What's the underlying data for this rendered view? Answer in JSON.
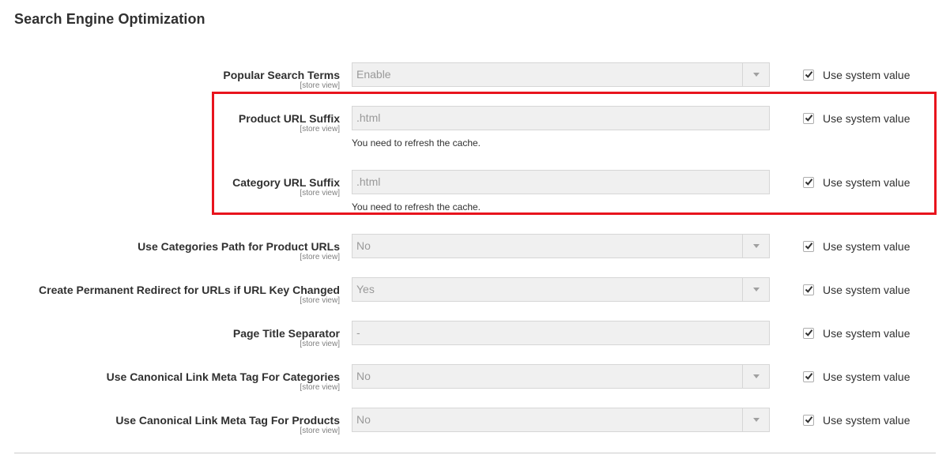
{
  "section": {
    "title": "Search Engine Optimization"
  },
  "rows": [
    {
      "label": "Popular Search Terms",
      "scope": "[store view]",
      "value": "Enable",
      "control": "select",
      "system_value_label": "Use system value",
      "checked": true
    },
    {
      "label": "Product URL Suffix",
      "scope": "[store view]",
      "value": ".html",
      "control": "text",
      "note": "You need to refresh the cache.",
      "system_value_label": "Use system value",
      "checked": true
    },
    {
      "label": "Category URL Suffix",
      "scope": "[store view]",
      "value": ".html",
      "control": "text",
      "note": "You need to refresh the cache.",
      "system_value_label": "Use system value",
      "checked": true
    },
    {
      "label": "Use Categories Path for Product URLs",
      "scope": "[store view]",
      "value": "No",
      "control": "select",
      "system_value_label": "Use system value",
      "checked": true
    },
    {
      "label": "Create Permanent Redirect for URLs if URL Key Changed",
      "scope": "[store view]",
      "value": "Yes",
      "control": "select",
      "system_value_label": "Use system value",
      "checked": true
    },
    {
      "label": "Page Title Separator",
      "scope": "[store view]",
      "value": "-",
      "control": "text",
      "system_value_label": "Use system value",
      "checked": true
    },
    {
      "label": "Use Canonical Link Meta Tag For Categories",
      "scope": "[store view]",
      "value": "No",
      "control": "select",
      "system_value_label": "Use system value",
      "checked": true
    },
    {
      "label": "Use Canonical Link Meta Tag For Products",
      "scope": "[store view]",
      "value": "No",
      "control": "select",
      "system_value_label": "Use system value",
      "checked": true
    }
  ],
  "colors": {
    "highlight": "#e8141d",
    "disabled_field": "#f0f0f0"
  }
}
